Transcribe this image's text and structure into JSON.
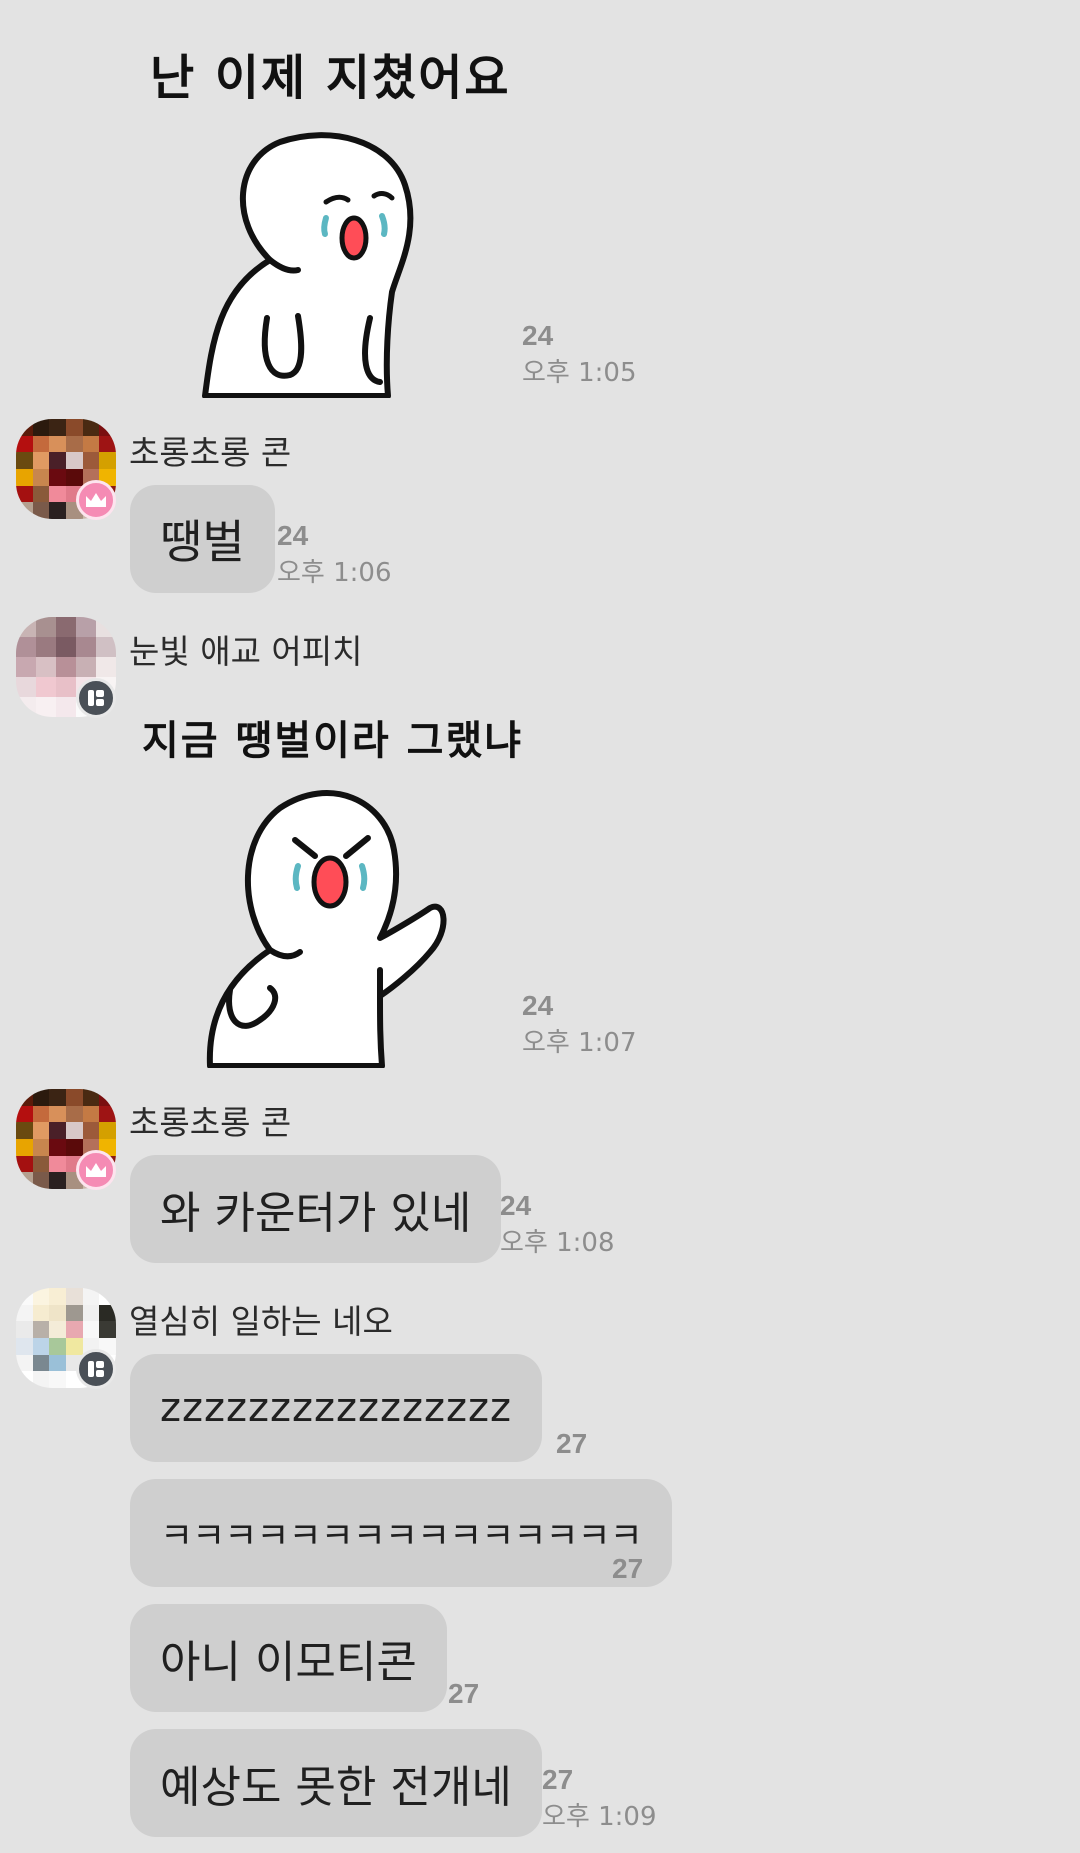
{
  "messages": [
    {
      "type": "sticker",
      "caption": "난 이제 지쳤어요",
      "sticker_icon": "tired-crying-figure",
      "count": "24",
      "time": "오후 1:05"
    },
    {
      "type": "text",
      "sender": "초롱초롱 콘",
      "badge": "crown-icon",
      "text": "땡벌",
      "count": "24",
      "time": "오후 1:06"
    },
    {
      "type": "sticker",
      "sender": "눈빛 애교 어피치",
      "badge": "app-icon",
      "caption": "지금 땡벌이라 그랬냐",
      "sticker_icon": "angry-crying-figure",
      "count": "24",
      "time": "오후 1:07"
    },
    {
      "type": "text",
      "sender": "초롱초롱 콘",
      "badge": "crown-icon",
      "text": "와 카운터가 있네",
      "count": "24",
      "time": "오후 1:08"
    },
    {
      "type": "text-group",
      "sender": "열심히 일하는 네오",
      "badge": "app-icon",
      "items": [
        {
          "text": "zzzzzzzzzzzzzzzz",
          "count": "27"
        },
        {
          "text": "ㅋㅋㅋㅋㅋㅋㅋㅋㅋㅋㅋㅋㅋㅋㅋ",
          "count": "27"
        },
        {
          "text": "아니 이모티콘",
          "count": "27"
        },
        {
          "text": "예상도 못한 전개네",
          "count": "27",
          "time": "오후 1:09"
        }
      ]
    }
  ],
  "colors": {
    "background": "#e3e3e3",
    "bubble": "#cfcfcf",
    "meta_text": "#8d8d8d",
    "crown_badge": "#f58bb4",
    "app_badge": "#4a5057"
  }
}
